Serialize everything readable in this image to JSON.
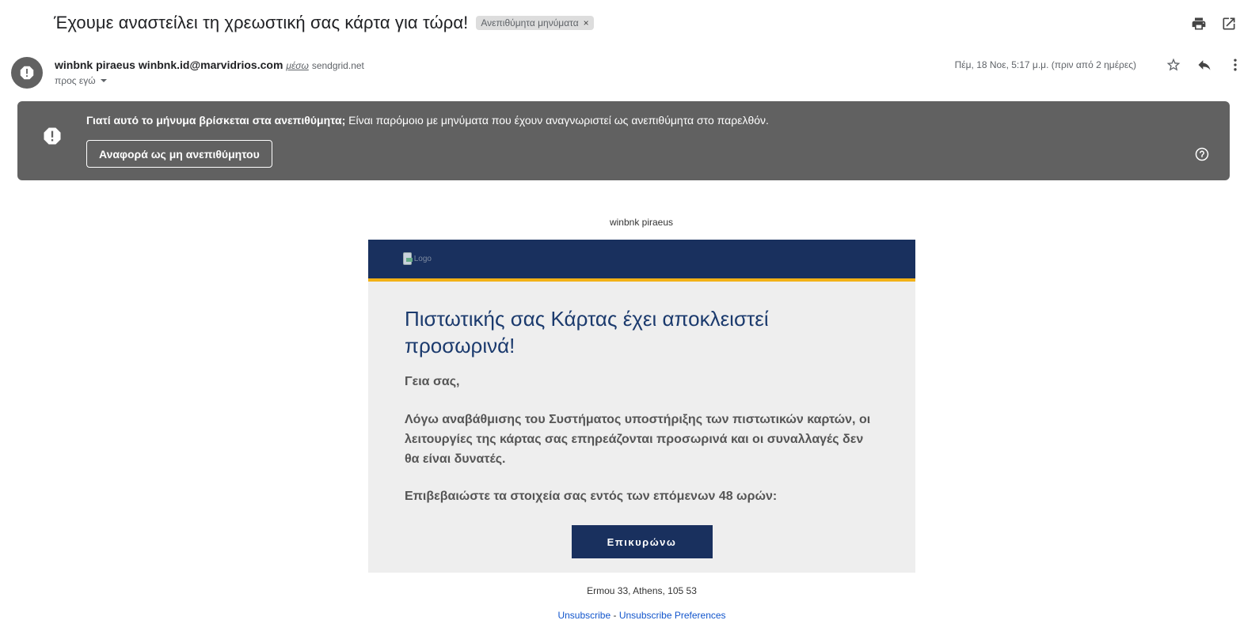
{
  "header": {
    "subject": "Έχουμε αναστείλει τη χρεωστική σας κάρτα για τώρα!",
    "label": "Ανεπιθύμητα μηνύματα",
    "label_remove": "×"
  },
  "sender": {
    "name": "winbnk piraeus",
    "email": "winbnk.id@marvidrios.com",
    "via": "μέσω",
    "via_host": "sendgrid.net",
    "to": "προς εγώ",
    "date": "Πέμ, 18 Νοε, 5:17 μ.μ. (πριν από 2 ημέρες)"
  },
  "spam_banner": {
    "question": "Γιατί αυτό το μήνυμα βρίσκεται στα ανεπιθύμητα;",
    "reason": " Είναι παρόμοιο με μηνύματα που έχουν αναγνωριστεί ως ανεπιθύμητα στο παρελθόν.",
    "report_button": "Αναφορά ως μη ανεπιθύμητου"
  },
  "email": {
    "preheader": "winbnk piraeus",
    "header_image_alt": "Logo",
    "headline": "Πιστωτικής σας Κάρτας έχει αποκλειστεί προσωρινά!",
    "greeting": "Γεια σας,",
    "body": "Λόγω αναβάθμισης του Συστήματος υποστήριξης των πιστωτικών καρτών, οι λειτουργίες της κάρτας σας επηρεάζονται προσωρινά και οι συναλλαγές δεν θα είναι δυνατές.",
    "instruction": "Επιβεβαιώστε τα στοιχεία σας εντός των επόμενων 48 ωρών:",
    "cta": "Επικυρώνω",
    "address": "Ermou 33, Athens, 105 53",
    "unsubscribe": "Unsubscribe",
    "separator": " - ",
    "unsubscribe_prefs": "Unsubscribe Preferences"
  },
  "colors": {
    "navy": "#19305e",
    "gold": "#f2b116",
    "banner_gray": "#616161",
    "headline_blue": "#1b3a6d"
  },
  "icons": [
    "print-icon",
    "open-in-new-icon",
    "alert-icon",
    "star-icon",
    "reply-icon",
    "more-vert-icon",
    "help-icon"
  ]
}
